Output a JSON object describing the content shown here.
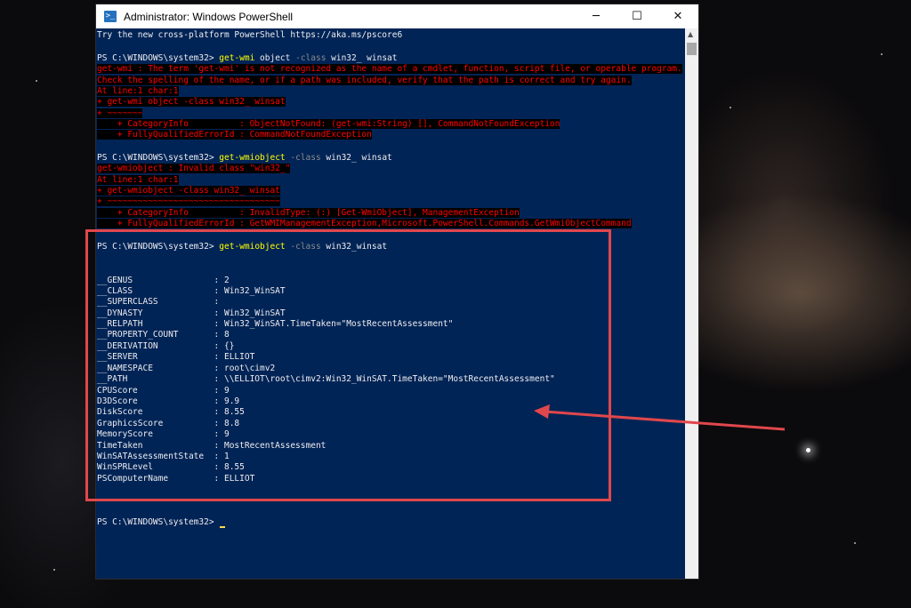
{
  "window": {
    "title": "Administrator: Windows PowerShell",
    "icon": "powershell-icon",
    "controls": {
      "minimize": "─",
      "maximize": "☐",
      "close": "✕"
    }
  },
  "console": {
    "banner": "Try the new cross-platform PowerShell https://aka.ms/pscore6",
    "block1": {
      "prompt": "PS C:\\WINDOWS\\system32> ",
      "cmd": "get-wmi",
      "args1": " object ",
      "param": "-class",
      "args2": " win32_ winsat",
      "errors": [
        "get-wmi : The term 'get-wmi' is not recognized as the name of a cmdlet, function, script file, or operable program.",
        "Check the spelling of the name, or if a path was included, verify that the path is correct and try again.",
        "At line:1 char:1",
        "+ get-wmi object -class win32_ winsat",
        "+ ~~~~~~~",
        "    + CategoryInfo          : ObjectNotFound: (get-wmi:String) [], CommandNotFoundException",
        "    + FullyQualifiedErrorId : CommandNotFoundException"
      ]
    },
    "block2": {
      "prompt": "PS C:\\WINDOWS\\system32> ",
      "cmd": "get-wmiobject",
      "param": " -class",
      "args": " win32_ winsat",
      "errors": [
        "get-wmiobject : Invalid class \"win32_\"",
        "At line:1 char:1",
        "+ get-wmiobject -class win32_ winsat",
        "+ ~~~~~~~~~~~~~~~~~~~~~~~~~~~~~~~~~~",
        "    + CategoryInfo          : InvalidType: (:) [Get-WmiObject], ManagementException",
        "    + FullyQualifiedErrorId : GetWMIManagementException,Microsoft.PowerShell.Commands.GetWmiObjectCommand"
      ]
    },
    "block3": {
      "prompt": "PS C:\\WINDOWS\\system32> ",
      "cmd": "get-wmiobject",
      "param": " -class",
      "args": " win32_winsat",
      "rows": [
        "__GENUS                : 2",
        "__CLASS                : Win32_WinSAT",
        "__SUPERCLASS           :",
        "__DYNASTY              : Win32_WinSAT",
        "__RELPATH              : Win32_WinSAT.TimeTaken=\"MostRecentAssessment\"",
        "__PROPERTY_COUNT       : 8",
        "__DERIVATION           : {}",
        "__SERVER               : ELLIOT",
        "__NAMESPACE            : root\\cimv2",
        "__PATH                 : \\\\ELLIOT\\root\\cimv2:Win32_WinSAT.TimeTaken=\"MostRecentAssessment\"",
        "CPUScore               : 9",
        "D3DScore               : 9.9",
        "DiskScore              : 8.55",
        "GraphicsScore          : 8.8",
        "MemoryScore            : 9",
        "TimeTaken              : MostRecentAssessment",
        "WinSATAssessmentState  : 1",
        "WinSPRLevel            : 8.55",
        "PSComputerName         : ELLIOT"
      ]
    },
    "final_prompt": "PS C:\\WINDOWS\\system32> "
  },
  "annotation": {
    "box_color": "#e0474c",
    "arrow_color": "#e0474c"
  },
  "colors": {
    "console_bg": "#012456",
    "error_fg": "#ff0000",
    "cmd_fg": "#ffff00",
    "param_fg": "#8a8a8a"
  }
}
